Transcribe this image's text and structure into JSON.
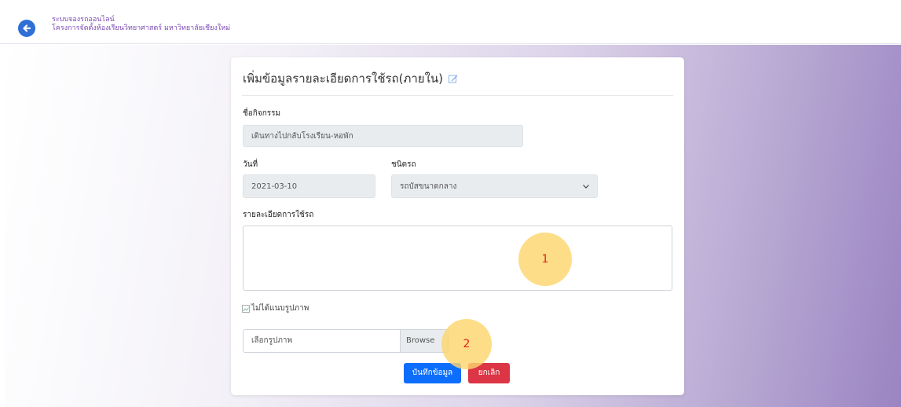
{
  "header": {
    "system_name": "ระบบจองรถออนไลน์",
    "org_name": "โครงการจัดตั้งห้องเรียนวิทยาศาสตร์ มหาวิทยาลัยเชียงใหม่",
    "back_icon": "arrow-left-circle-icon"
  },
  "form": {
    "title": "เพิ่มข้อมูลรายละเอียดการใช้รถ(ภายใน)",
    "activity_label": "ชื่อกิจกรรม",
    "activity_value": "เดินทางไปกลับโรงเรียน-หอพัก",
    "date_label": "วันที่",
    "date_value": "2021-03-10",
    "vehicle_label": "ชนิดรถ",
    "vehicle_value": "รถบัสขนาดกลาง",
    "details_label": "รายละเอียดการใช้รถ",
    "details_value": "",
    "image_alt": "ไม่ได้แนบรูปภาพ",
    "file_placeholder": "เลือกรูปภาพ",
    "browse_label": "Browse",
    "save_label": "บันทึกข้อมูล",
    "cancel_label": "ยกเลิก"
  },
  "markers": [
    "1",
    "2"
  ],
  "colors": {
    "primary": "#0d6efd",
    "danger": "#dc3545",
    "brand_text": "#7a49b2",
    "marker_fill": "#fdd66e",
    "marker_text": "#e3201b"
  }
}
